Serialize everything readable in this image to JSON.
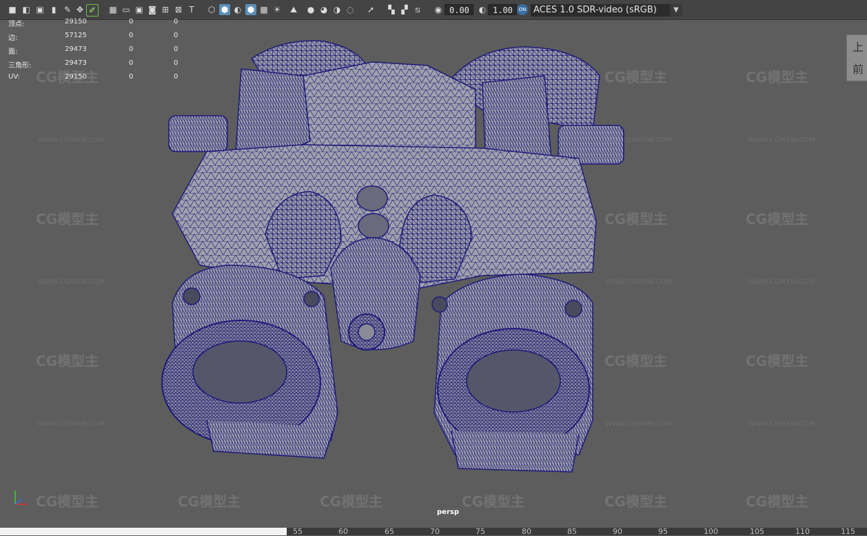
{
  "toolbar": {
    "exposure_value": "0.00",
    "gamma_value": "1.00",
    "color_space": "ACES 1.0 SDR-video (sRGB)"
  },
  "hud": {
    "rows": [
      {
        "label": "顶点:",
        "v1": "29150",
        "v2": "0",
        "v3": "0"
      },
      {
        "label": "边:",
        "v1": "57125",
        "v2": "0",
        "v3": "0"
      },
      {
        "label": "面:",
        "v1": "29473",
        "v2": "0",
        "v3": "0"
      },
      {
        "label": "三角形:",
        "v1": "29473",
        "v2": "0",
        "v3": "0"
      },
      {
        "label": "UV:",
        "v1": "29150",
        "v2": "0",
        "v3": "0"
      }
    ]
  },
  "viewcube": {
    "top": "上",
    "front": "前"
  },
  "viewport": {
    "camera": "persp"
  },
  "timeline": {
    "ticks": [
      "55",
      "60",
      "65",
      "70",
      "75",
      "80",
      "85",
      "90",
      "95",
      "100",
      "105",
      "110",
      "115"
    ]
  },
  "watermark": {
    "logo": "CG模型主",
    "url": "WWW.CGMXW.COM"
  },
  "colors": {
    "wire": "#1d1a78",
    "surface": "#9a9aa8",
    "background": "#5d5d5d",
    "accent": "#5b8fb9"
  }
}
